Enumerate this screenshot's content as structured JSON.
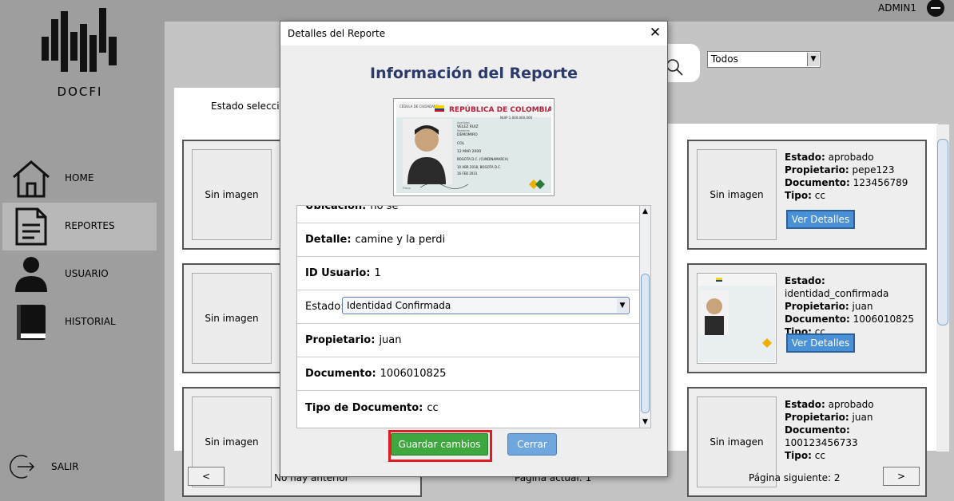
{
  "header": {
    "user_name": "ADMIN1"
  },
  "sidebar": {
    "logo_text": "DOCFI",
    "items": [
      {
        "label": "HOME",
        "icon": "home-icon"
      },
      {
        "label": "REPORTES",
        "icon": "document-icon",
        "active": true
      },
      {
        "label": "USUARIO",
        "icon": "user-icon"
      },
      {
        "label": "HISTORIAL",
        "icon": "book-icon"
      }
    ],
    "exit_label": "SALIR"
  },
  "main": {
    "filter_value": "Todos",
    "status_label": "Estado seleccio",
    "cards": [
      {
        "image": "Sin imagen"
      },
      {
        "image": "Sin imagen"
      },
      {
        "image": "Sin imagen"
      },
      {
        "image": "Sin imagen",
        "estado": "aprobado",
        "propietario": "pepe123",
        "documento": "123456789",
        "tipo": "cc",
        "button": "Ver Detalles"
      },
      {
        "image": "",
        "estado": "identidad_confirmada",
        "propietario": "juan",
        "documento": "1006010825",
        "tipo": "cc",
        "button": "Ver Detalles"
      },
      {
        "image": "Sin imagen",
        "estado": "aprobado",
        "propietario": "juan",
        "documento": "100123456733",
        "tipo": "cc"
      }
    ],
    "labels": {
      "estado": "Estado:",
      "propietario": "Propietario:",
      "documento": "Documento:",
      "tipo": "Tipo:"
    },
    "pagination": {
      "prev": "<",
      "next": ">",
      "prev_label": "No hay anterior",
      "current_label": "Página actual: 1",
      "next_label": "Página siguiente: 2"
    }
  },
  "dialog": {
    "title": "Detalles del Reporte",
    "close": "✕",
    "heading": "Información del Reporte",
    "id_card": {
      "header_left": "CÉDULA DE CIUDADANÍA",
      "country": "REPÚBLICA DE COLOMBIA",
      "nuip": "NUIP 1.000.000.000",
      "surname_label": "Apellidos",
      "surname": "VELEZ RUIZ",
      "name_label": "Nombres",
      "name": "DEMOMIRO",
      "nationality": "COL",
      "dob": "12 MAR 2000",
      "place": "BOGOTA D.C. (CUNDINAMARCA)",
      "issue": "10 ABR 2018, BOGOTA D.C.",
      "expiry": "16 FEB 2031",
      "signature_label": "Firma"
    },
    "fields": [
      {
        "label": "Ubicación:",
        "value": "no se",
        "bold": true
      },
      {
        "label": "Detalle:",
        "value": "camine y la perdi",
        "bold": true
      },
      {
        "label": "ID Usuario:",
        "value": "1",
        "bold": true
      },
      {
        "label": "Estado:",
        "value": "Identidad Confirmada",
        "bold": false,
        "type": "select"
      },
      {
        "label": "Propietario:",
        "value": "juan",
        "bold": true
      },
      {
        "label": "Documento:",
        "value": "1006010825",
        "bold": true
      },
      {
        "label": "Tipo de Documento:",
        "value": "cc",
        "bold": true
      }
    ],
    "save_label": "Guardar cambios",
    "cancel_label": "Cerrar"
  },
  "colors": {
    "save_button": "#3ea83e",
    "cancel_button": "#6fa6de",
    "details_button": "#4a90d6",
    "highlight": "#e01b24",
    "heading": "#2b3a6b"
  }
}
